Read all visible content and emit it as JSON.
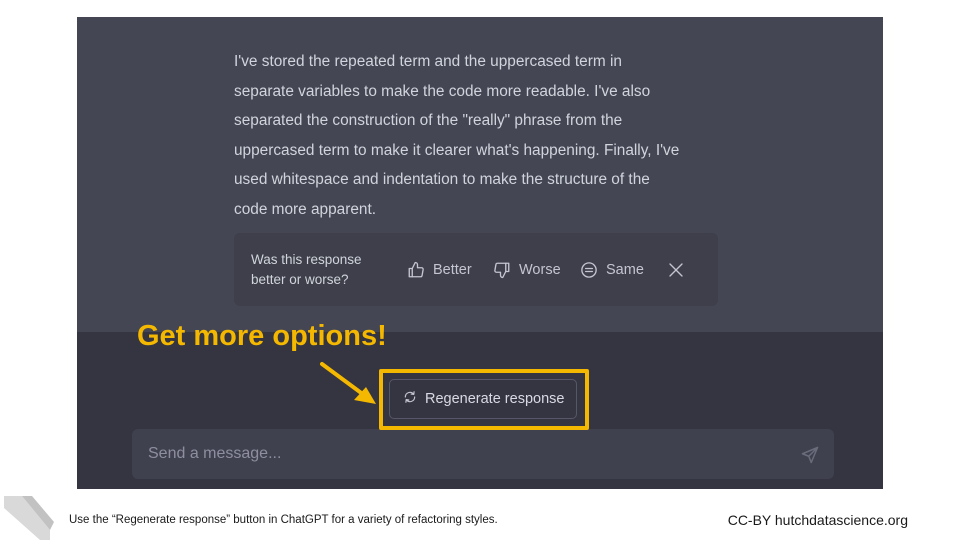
{
  "assistant_message": {
    "lines": [
      "I've stored the repeated term and the uppercased term in",
      "separate variables to make the code more readable. I've also",
      "separated the construction of the \"really\" phrase from the",
      "uppercased term to make it clearer what's happening. Finally, I've",
      "used whitespace and indentation to make the structure of the",
      "code more apparent."
    ]
  },
  "feedback": {
    "question_line1": "Was this response",
    "question_line2": "better or worse?",
    "better_label": "Better",
    "worse_label": "Worse",
    "same_label": "Same",
    "better_icon": "thumbs-up-icon",
    "worse_icon": "thumbs-down-icon",
    "same_icon": "equal-circle-icon",
    "close_icon": "close-icon"
  },
  "regenerate": {
    "label": "Regenerate response",
    "icon": "refresh-icon"
  },
  "composer": {
    "placeholder": "Send a message...",
    "send_icon": "send-icon"
  },
  "annotation": {
    "text": "Get more options!",
    "color": "#f5b800"
  },
  "slide": {
    "caption": "Use the “Regenerate response” button in ChatGPT for a variety of refactoring styles.",
    "credit": "CC-BY hutchdatascience.org"
  },
  "colors": {
    "chat_bg": "#444654",
    "page_bg": "#343541",
    "highlight": "#f5b800"
  }
}
